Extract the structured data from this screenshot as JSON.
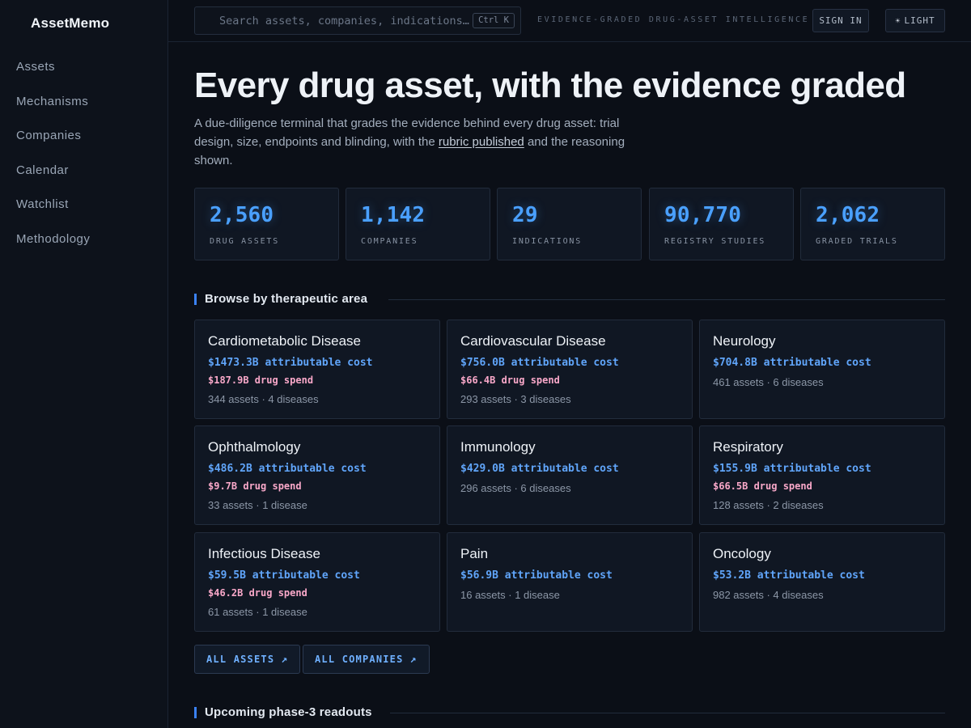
{
  "app": {
    "brand": "AssetMemo"
  },
  "sidebar": {
    "items": [
      {
        "label": "Assets"
      },
      {
        "label": "Mechanisms"
      },
      {
        "label": "Companies"
      },
      {
        "label": "Calendar"
      },
      {
        "label": "Watchlist"
      },
      {
        "label": "Methodology"
      }
    ]
  },
  "topbar": {
    "search_placeholder": "Search assets, companies, indications…",
    "search_shortcut": "Ctrl K",
    "tagline": "EVIDENCE-GRADED DRUG-ASSET INTELLIGENCE",
    "signin_label": "SIGN IN",
    "theme_label": "LIGHT",
    "theme_icon": "sun-icon"
  },
  "hero": {
    "title": "Every drug asset, with the evidence graded",
    "subtitle_before": "A due-diligence terminal that grades the evidence behind every drug asset: trial design, size, endpoints and blinding, with the ",
    "subtitle_link": "rubric published",
    "subtitle_after": " and the reasoning shown."
  },
  "stats": [
    {
      "value": "2,560",
      "label": "DRUG ASSETS"
    },
    {
      "value": "1,142",
      "label": "COMPANIES"
    },
    {
      "value": "29",
      "label": "INDICATIONS"
    },
    {
      "value": "90,770",
      "label": "REGISTRY STUDIES"
    },
    {
      "value": "2,062",
      "label": "GRADED TRIALS"
    }
  ],
  "browse": {
    "title": "Browse by therapeutic area",
    "areas": [
      {
        "name": "Cardiometabolic Disease",
        "cost": "$1473.3B attributable cost",
        "spend": "$187.9B drug spend",
        "meta": "344 assets · 4 diseases"
      },
      {
        "name": "Cardiovascular Disease",
        "cost": "$756.0B attributable cost",
        "spend": "$66.4B drug spend",
        "meta": "293 assets · 3 diseases"
      },
      {
        "name": "Neurology",
        "cost": "$704.8B attributable cost",
        "spend": "",
        "meta": "461 assets · 6 diseases"
      },
      {
        "name": "Ophthalmology",
        "cost": "$486.2B attributable cost",
        "spend": "$9.7B drug spend",
        "meta": "33 assets · 1 disease"
      },
      {
        "name": "Immunology",
        "cost": "$429.0B attributable cost",
        "spend": "",
        "meta": "296 assets · 6 diseases"
      },
      {
        "name": "Respiratory",
        "cost": "$155.9B attributable cost",
        "spend": "$66.5B drug spend",
        "meta": "128 assets · 2 diseases"
      },
      {
        "name": "Infectious Disease",
        "cost": "$59.5B attributable cost",
        "spend": "$46.2B drug spend",
        "meta": "61 assets · 1 disease"
      },
      {
        "name": "Pain",
        "cost": "$56.9B attributable cost",
        "spend": "",
        "meta": "16 assets · 1 disease"
      },
      {
        "name": "Oncology",
        "cost": "$53.2B attributable cost",
        "spend": "",
        "meta": "982 assets · 4 diseases"
      }
    ],
    "all_assets_label": "ALL ASSETS",
    "all_companies_label": "ALL COMPANIES"
  },
  "readouts": {
    "title": "Upcoming phase-3 readouts"
  },
  "colors": {
    "accent": "#4aa0ff",
    "cost": "#60a5fa",
    "spend": "#f9a8c9",
    "background": "#0b0f17"
  }
}
